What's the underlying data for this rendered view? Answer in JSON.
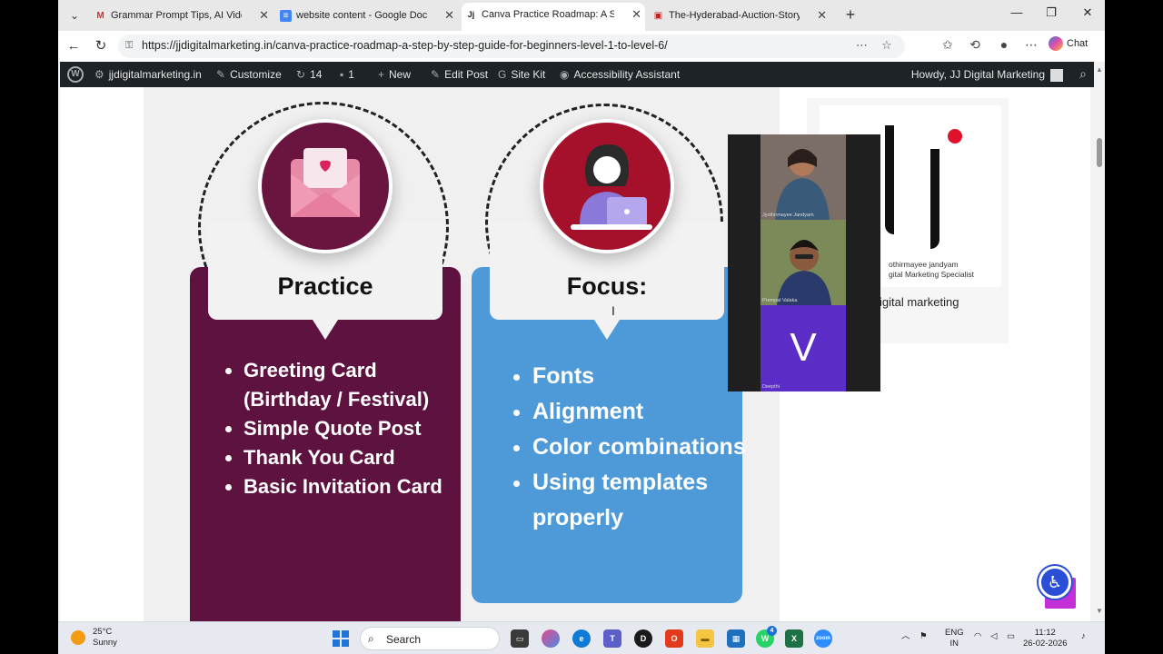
{
  "browser": {
    "tabs": [
      {
        "label": "Grammar Prompt Tips, AI Video A",
        "icon": "gmail-icon",
        "glyph": "M",
        "color": "#d93025"
      },
      {
        "label": "website content - Google Docs",
        "icon": "docs-icon",
        "glyph": "≡",
        "color": "#4285f4"
      },
      {
        "label": "Canva Practice Roadmap: A Step-",
        "icon": "jj-site-icon",
        "glyph": "Jj",
        "color": "#222222"
      },
      {
        "label": "The-Hyderabad-Auction-Story-Me",
        "icon": "pdf-icon",
        "glyph": "▣",
        "color": "#c5221f"
      }
    ],
    "close_glyph": "✕",
    "new_tab_glyph": "+",
    "url": "https://jjdigitalmarketing.in/canva-practice-roadmap-a-step-by-step-guide-for-beginners-level-1-to-level-6/",
    "chat_label": "Chat"
  },
  "wpbar": {
    "site": "jjdigitalmarketing.in",
    "customize": "Customize",
    "updates": "14",
    "comments": "1",
    "new": "New",
    "edit_post": "Edit Post",
    "site_kit": "Site Kit",
    "accessibility": "Accessibility Assistant",
    "howdy": "Howdy, JJ Digital Marketing"
  },
  "slide": {
    "practice_title": "Practice",
    "practice_items": [
      "Greeting Card (Birthday / Festival)",
      " Simple Quote Post",
      " Thank You Card",
      " Basic Invitation Card"
    ],
    "focus_title": "Focus:",
    "focus_items": [
      "Fonts",
      "Alignment",
      "Color combinations",
      "Using templates properly"
    ]
  },
  "logo": {
    "name_line1": "othirmayee jandyam",
    "name_line2": "gital Marketing Specialist",
    "tagline": "igital marketing"
  },
  "video_call": {
    "participants": [
      {
        "name": "Jyothirmayee Jandyam"
      },
      {
        "name": "Prempal Valaka"
      },
      {
        "name": "Deepthi",
        "initial": "V"
      }
    ]
  },
  "taskbar": {
    "temperature": "25°C",
    "weather": "Sunny",
    "search": "Search",
    "lang1": "ENG",
    "lang2": "IN",
    "time": "11:12",
    "date": "26-02-2026",
    "whatsapp_badge": "4"
  },
  "colors": {
    "practice_card": "#5e1240",
    "focus_card": "#4e9ad8",
    "wp_bar": "#1d2327",
    "logo_dot": "#e0112b"
  }
}
